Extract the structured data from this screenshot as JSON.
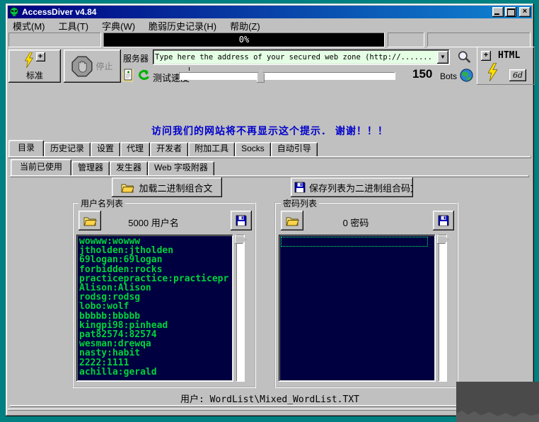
{
  "window": {
    "title": "AccessDiver v4.84"
  },
  "menu": {
    "items": [
      "模式(M)",
      "工具(T)",
      "字典(W)",
      "脆弱历史记录(H)",
      "帮助(Z)"
    ]
  },
  "progress": {
    "label": "0%"
  },
  "toolbar": {
    "standard": {
      "label": "标准",
      "plus": "+"
    },
    "stop": {
      "label": "停止"
    },
    "server": {
      "label": "服务器",
      "value": "Type here the address of your secured web zone (http://......."
    },
    "speed": {
      "label": "测试速度"
    },
    "bots": {
      "count": "150",
      "label": "Bots"
    },
    "html": {
      "plus": "+",
      "label": "HTML",
      "badge": "6d"
    }
  },
  "notice": {
    "text": "访问我们的网站将不再显示这个提示． 谢谢！！！"
  },
  "tabs": {
    "main": [
      "目录",
      "历史记录",
      "设置",
      "代理",
      "开发者",
      "附加工具",
      "Socks",
      "自动引导"
    ],
    "sub": [
      "当前已使用",
      "管理器",
      "发生器",
      "Web 字吸附器"
    ]
  },
  "combo": {
    "load_label": "加载二进制组合文",
    "save_label": "保存列表为二进制组合码文"
  },
  "users": {
    "group_title": "用户名列表",
    "count_label": "5000 用户名",
    "entries": [
      "wowww:wowww",
      "jtholden:jtholden",
      "69logan:69logan",
      "forbidden:rocks",
      "practicepractice:practicepr",
      "Alison:Alison",
      "rodsg:rodsg",
      "lobo:wolf",
      "bbbbb:bbbbb",
      "kingpi98:pinhead",
      "pat82574:82574",
      "wesman:drewqa",
      "nasty:habit",
      "2222:1111",
      "achilla:gerald"
    ]
  },
  "passwords": {
    "group_title": "密码列表",
    "count_label": "0 密码"
  },
  "status": {
    "wordlist": "用户: WordList\\Mixed_WordList.TXT"
  }
}
